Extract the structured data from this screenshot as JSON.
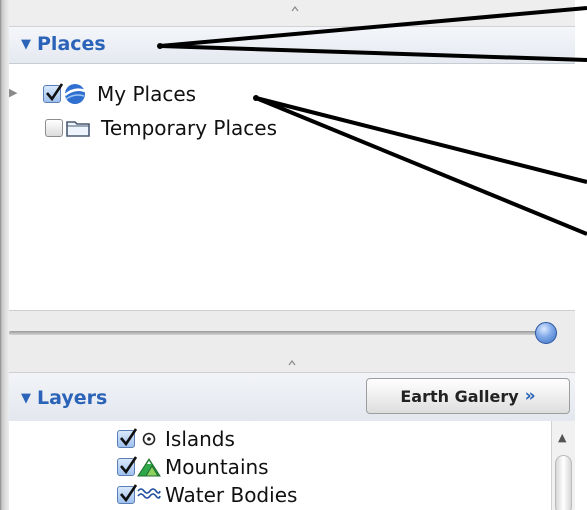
{
  "places_panel": {
    "title": "Places",
    "items": [
      {
        "label": "My Places",
        "checked": true,
        "expandable": true,
        "icon": "google-earth-globe-icon"
      },
      {
        "label": "Temporary Places",
        "checked": false,
        "expandable": false,
        "icon": "folder-icon"
      }
    ]
  },
  "slider": {
    "value": 1.0
  },
  "layers_panel": {
    "title": "Layers",
    "gallery_button": {
      "label": "Earth Gallery",
      "chevron": "»"
    },
    "items": [
      {
        "label": "Islands",
        "checked": true,
        "icon": "island-target-icon"
      },
      {
        "label": "Mountains",
        "checked": true,
        "icon": "mountain-icon"
      },
      {
        "label": "Water Bodies",
        "checked": true,
        "icon": "water-waves-icon"
      }
    ]
  },
  "colors": {
    "section_title": "#2b63b8",
    "checkbox_on": "#9fc1ee",
    "slider_thumb": "#3d6fc1"
  }
}
